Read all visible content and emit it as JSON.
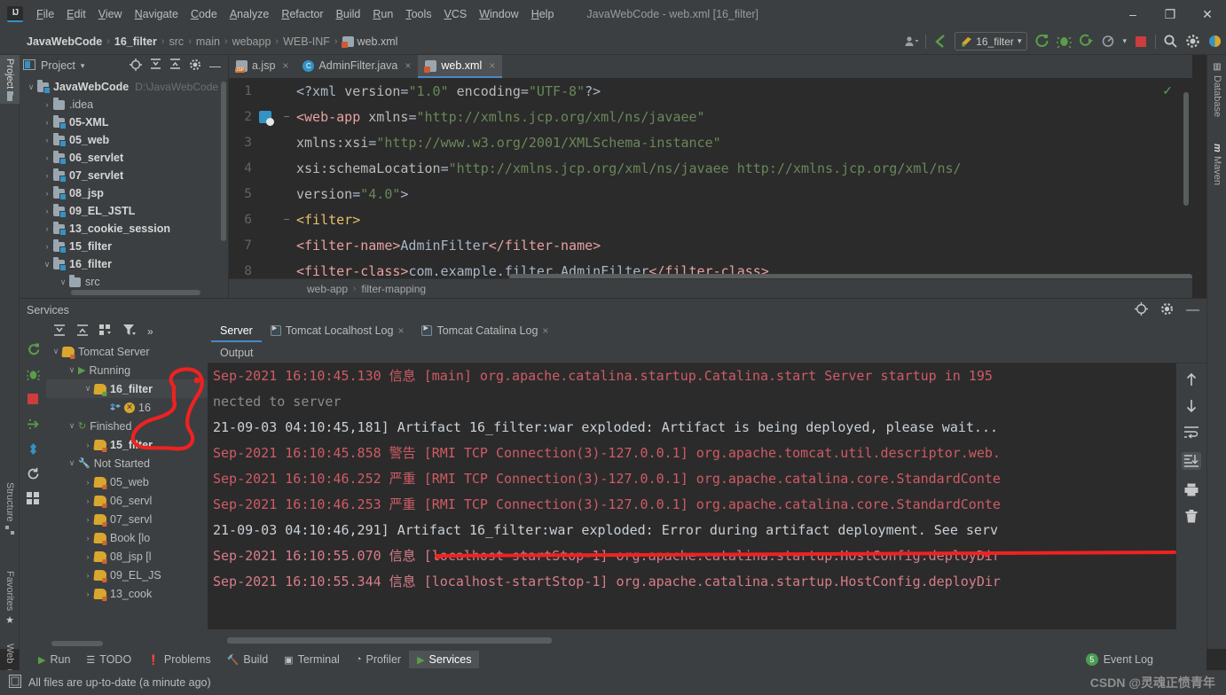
{
  "window": {
    "title": "JavaWebCode - web.xml [16_filter]",
    "minimize": "–",
    "maximize": "❐",
    "close": "✕",
    "logo": "IJ"
  },
  "menubar": {
    "items": [
      "File",
      "Edit",
      "View",
      "Navigate",
      "Code",
      "Analyze",
      "Refactor",
      "Build",
      "Run",
      "Tools",
      "VCS",
      "Window",
      "Help"
    ]
  },
  "navbar": {
    "crumbs": [
      "JavaWebCode",
      "16_filter",
      "src",
      "main",
      "webapp",
      "WEB-INF",
      "web.xml"
    ],
    "separator": "›",
    "run_config": "16_filter",
    "dropdown_caret": "▾",
    "icons": {
      "profile": "profile-icon",
      "back": "back-arrow-icon",
      "run": "run-icon",
      "debug": "debug-icon",
      "run_coverage": "run-coverage-icon",
      "profiler": "profiler-icon",
      "stop": "stop-icon",
      "search": "search-icon",
      "settings": "gear-icon",
      "account": "account-icon"
    }
  },
  "left_strip": {
    "tabs": [
      "Project",
      "Structure",
      "Favorites",
      "Web"
    ]
  },
  "right_strip": {
    "tabs": [
      "Database",
      "Maven"
    ]
  },
  "project_panel": {
    "title": "Project",
    "caret": "▾",
    "icons": [
      "locate-icon",
      "expand-all-icon",
      "collapse-all-icon",
      "gear-icon",
      "hide-icon"
    ],
    "tree": [
      {
        "arrow": "∨",
        "label": "JavaWebCode",
        "bold": true,
        "path": "D:\\JavaWebCode",
        "indent": 0,
        "mod": true
      },
      {
        "arrow": "›",
        "label": ".idea",
        "bold": false,
        "path": "",
        "indent": 1,
        "mod": false
      },
      {
        "arrow": "›",
        "label": "05-XML",
        "bold": true,
        "path": "",
        "indent": 1,
        "mod": true
      },
      {
        "arrow": "›",
        "label": "05_web",
        "bold": true,
        "path": "",
        "indent": 1,
        "mod": true
      },
      {
        "arrow": "›",
        "label": "06_servlet",
        "bold": true,
        "path": "",
        "indent": 1,
        "mod": true
      },
      {
        "arrow": "›",
        "label": "07_servlet",
        "bold": true,
        "path": "",
        "indent": 1,
        "mod": true
      },
      {
        "arrow": "›",
        "label": "08_jsp",
        "bold": true,
        "path": "",
        "indent": 1,
        "mod": true
      },
      {
        "arrow": "›",
        "label": "09_EL_JSTL",
        "bold": true,
        "path": "",
        "indent": 1,
        "mod": true
      },
      {
        "arrow": "›",
        "label": "13_cookie_session",
        "bold": true,
        "path": "",
        "indent": 1,
        "mod": true
      },
      {
        "arrow": "›",
        "label": "15_filter",
        "bold": true,
        "path": "",
        "indent": 1,
        "mod": true
      },
      {
        "arrow": "∨",
        "label": "16_filter",
        "bold": true,
        "path": "",
        "indent": 1,
        "mod": true
      },
      {
        "arrow": "∨",
        "label": "src",
        "bold": false,
        "path": "",
        "indent": 2,
        "mod": false
      }
    ]
  },
  "editor": {
    "tabs": [
      {
        "label": "a.jsp",
        "icon": "jsp-file-icon",
        "active": false,
        "close": "×"
      },
      {
        "label": "AdminFilter.java",
        "icon": "java-file-icon",
        "active": false,
        "close": "×"
      },
      {
        "label": "web.xml",
        "icon": "xml-file-icon",
        "active": true,
        "close": "×"
      }
    ],
    "lines": [
      {
        "num": "1",
        "indent": 0,
        "fold": "",
        "parts": [
          {
            "t": "<?xml ",
            "c": "punct"
          },
          {
            "t": "version",
            "c": "attr"
          },
          {
            "t": "=",
            "c": "punct"
          },
          {
            "t": "\"1.0\"",
            "c": "str"
          },
          {
            "t": " encoding",
            "c": "attr"
          },
          {
            "t": "=",
            "c": "punct"
          },
          {
            "t": "\"UTF-8\"",
            "c": "str"
          },
          {
            "t": "?>",
            "c": "punct"
          }
        ]
      },
      {
        "num": "2",
        "indent": 0,
        "fold": "−",
        "parts": [
          {
            "t": "<web-app",
            "c": "pink"
          },
          {
            "t": " xmlns",
            "c": "attr"
          },
          {
            "t": "=",
            "c": "punct"
          },
          {
            "t": "\"http://xmlns.jcp.org/xml/ns/javaee\"",
            "c": "str"
          }
        ]
      },
      {
        "num": "3",
        "indent": 1,
        "fold": "",
        "parts": [
          {
            "t": "        xmlns:xsi",
            "c": "attr"
          },
          {
            "t": "=",
            "c": "punct"
          },
          {
            "t": "\"http://www.w3.org/2001/XMLSchema-instance\"",
            "c": "str"
          }
        ]
      },
      {
        "num": "4",
        "indent": 1,
        "fold": "",
        "parts": [
          {
            "t": "        xsi:schemaLocation",
            "c": "attr"
          },
          {
            "t": "=",
            "c": "punct"
          },
          {
            "t": "\"http://xmlns.jcp.org/xml/ns/javaee http://xmlns.jcp.org/xml/ns/",
            "c": "str"
          }
        ]
      },
      {
        "num": "5",
        "indent": 1,
        "fold": "",
        "parts": [
          {
            "t": "        version",
            "c": "attr"
          },
          {
            "t": "=",
            "c": "punct"
          },
          {
            "t": "\"4.0\"",
            "c": "str"
          },
          {
            "t": ">",
            "c": "punct"
          }
        ]
      },
      {
        "num": "6",
        "indent": 0,
        "fold": "−",
        "parts": [
          {
            "t": "    <filter>",
            "c": "elem"
          }
        ]
      },
      {
        "num": "7",
        "indent": 0,
        "fold": "",
        "parts": [
          {
            "t": "        <filter-name>",
            "c": "pink"
          },
          {
            "t": "AdminFilter",
            "c": "punct"
          },
          {
            "t": "</filter-name>",
            "c": "pink"
          }
        ]
      },
      {
        "num": "8",
        "indent": 0,
        "fold": "",
        "parts": [
          {
            "t": "        <filter-class>",
            "c": "pink"
          },
          {
            "t": "com.example.filter.AdminFilter",
            "c": "punct"
          },
          {
            "t": "</filter-class>",
            "c": "pink"
          }
        ]
      }
    ],
    "breadcrumbs": [
      "web-app",
      "filter-mapping"
    ],
    "breadcrumb_sep": "›",
    "inspection_ok": "✓"
  },
  "services": {
    "title": "Services",
    "header_icons": [
      "locate-icon",
      "gear-icon",
      "hide-icon"
    ],
    "minimize": "—",
    "vtoolbar_icons": [
      "rerun-icon",
      "debug-icon",
      "stop-icon",
      "deploy-icon",
      "edit-configurations-icon",
      "refresh-icon"
    ],
    "tree_toolbar_icons": [
      "expand-all-icon",
      "collapse-all-icon",
      "group-icon",
      "filter-icon",
      "more-icon"
    ],
    "more": "»",
    "tree": [
      {
        "arrow": "∨",
        "label": "Tomcat Server",
        "indent": 0,
        "kind": "tomcat",
        "bold": false,
        "sel": false
      },
      {
        "arrow": "∨",
        "label": "Running",
        "indent": 1,
        "kind": "running",
        "bold": false,
        "sel": false
      },
      {
        "arrow": "∨",
        "label": "16_filter",
        "indent": 2,
        "kind": "tomcat-green",
        "bold": true,
        "sel": true
      },
      {
        "arrow": "",
        "label": "16",
        "indent": 3,
        "kind": "artifact-error",
        "bold": false,
        "sel": false
      },
      {
        "arrow": "∨",
        "label": "Finished",
        "indent": 1,
        "kind": "finished",
        "bold": false,
        "sel": false
      },
      {
        "arrow": "›",
        "label": "15_filter",
        "indent": 2,
        "kind": "tomcat",
        "bold": true,
        "sel": false
      },
      {
        "arrow": "∨",
        "label": "Not Started",
        "indent": 1,
        "kind": "wrench",
        "bold": false,
        "sel": false
      },
      {
        "arrow": "›",
        "label": "05_web",
        "indent": 2,
        "kind": "tomcat",
        "bold": false,
        "sel": false
      },
      {
        "arrow": "›",
        "label": "06_servl",
        "indent": 2,
        "kind": "tomcat",
        "bold": false,
        "sel": false
      },
      {
        "arrow": "›",
        "label": "07_servl",
        "indent": 2,
        "kind": "tomcat",
        "bold": false,
        "sel": false
      },
      {
        "arrow": "›",
        "label": "Book [lo",
        "indent": 2,
        "kind": "tomcat",
        "bold": false,
        "sel": false
      },
      {
        "arrow": "›",
        "label": "08_jsp [l",
        "indent": 2,
        "kind": "tomcat",
        "bold": false,
        "sel": false
      },
      {
        "arrow": "›",
        "label": "09_EL_JS",
        "indent": 2,
        "kind": "tomcat",
        "bold": false,
        "sel": false
      },
      {
        "arrow": "›",
        "label": "13_cook",
        "indent": 2,
        "kind": "tomcat",
        "bold": false,
        "sel": false
      }
    ],
    "tabs": [
      {
        "label": "Server",
        "active": true,
        "icon": "",
        "close": ""
      },
      {
        "label": "Tomcat Localhost Log",
        "active": false,
        "icon": "run-icon",
        "close": "×"
      },
      {
        "label": "Tomcat Catalina Log",
        "active": false,
        "icon": "run-icon",
        "close": "×"
      }
    ],
    "output_label": "Output",
    "console_toolbar_icons": [
      "scroll-up-icon",
      "scroll-down-icon",
      "soft-wrap-icon",
      "scroll-to-end-icon",
      "print-icon",
      "clear-all-icon"
    ],
    "console_lines": [
      {
        "text": "Sep-2021 16:10:45.130 信息 [main] org.apache.catalina.startup.Catalina.start Server startup in 195",
        "color": "lg-red"
      },
      {
        "text": "nected to server",
        "color": "lg-grey"
      },
      {
        "text": "21-09-03 04:10:45,181] Artifact 16_filter:war exploded: Artifact is being deployed, please wait...",
        "color": "lg-white"
      },
      {
        "text": "Sep-2021 16:10:45.858 警告 [RMI TCP Connection(3)-127.0.0.1] org.apache.tomcat.util.descriptor.web.",
        "color": "lg-red"
      },
      {
        "text": "Sep-2021 16:10:46.252 严重 [RMI TCP Connection(3)-127.0.0.1] org.apache.catalina.core.StandardConte",
        "color": "lg-red"
      },
      {
        "text": "Sep-2021 16:10:46.253 严重 [RMI TCP Connection(3)-127.0.0.1] org.apache.catalina.core.StandardConte",
        "color": "lg-red"
      },
      {
        "text": "21-09-03 04:10:46,291] Artifact 16_filter:war exploded: Error during artifact deployment. See serv",
        "color": "lg-white"
      },
      {
        "text": "Sep-2021 16:10:55.070 信息 [localhost-startStop-1] org.apache.catalina.startup.HostConfig.deployDir",
        "color": "lg-pink"
      },
      {
        "text": "Sep-2021 16:10:55.344 信息 [localhost-startStop-1] org.apache.catalina.startup.HostConfig.deployDir",
        "color": "lg-pink"
      }
    ]
  },
  "tool_buttons": [
    {
      "label": "Run",
      "icon": "run-icon",
      "active": false
    },
    {
      "label": "TODO",
      "icon": "todo-icon",
      "active": false
    },
    {
      "label": "Problems",
      "icon": "problems-icon",
      "active": false
    },
    {
      "label": "Build",
      "icon": "build-hammer-icon",
      "active": false
    },
    {
      "label": "Terminal",
      "icon": "terminal-icon",
      "active": false
    },
    {
      "label": "Profiler",
      "icon": "profiler-icon",
      "active": false
    },
    {
      "label": "Services",
      "icon": "services-icon",
      "active": true
    }
  ],
  "event_log": {
    "label": "Event Log",
    "count": "5"
  },
  "statusbar": {
    "message": "All files are up-to-date (a minute ago)",
    "icon": "file-status-icon"
  },
  "watermark": "CSDN @灵魂正愤青年",
  "colors": {
    "accent": "#4a88c7",
    "panel": "#3c3f41",
    "editor_bg": "#2b2b2b",
    "annotation_red": "#ee2222",
    "error_red": "#cf5b65",
    "string_green": "#6a8759",
    "tag_yellow": "#e8bf6a"
  }
}
